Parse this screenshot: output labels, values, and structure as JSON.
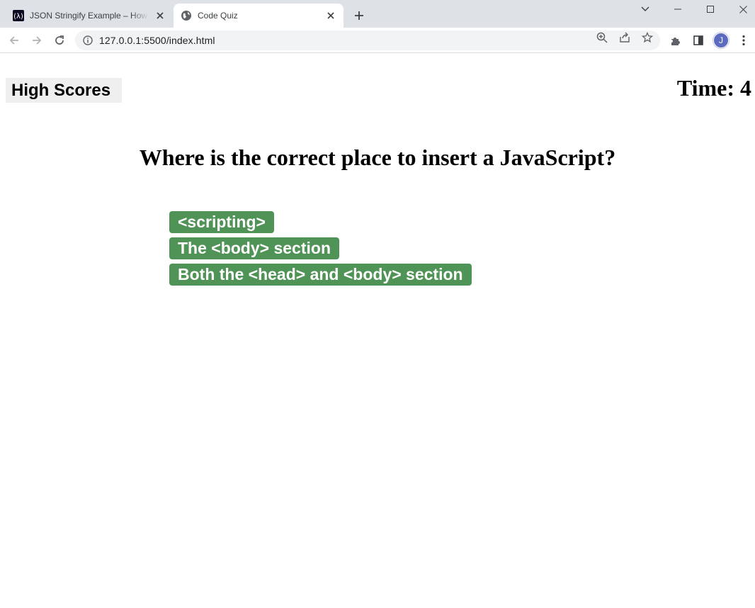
{
  "browser": {
    "tabs": [
      {
        "title": "JSON Stringify Example – How to",
        "active": false,
        "favicon": "freecodecamp-icon"
      },
      {
        "title": "Code Quiz",
        "active": true,
        "favicon": "globe-icon"
      }
    ],
    "url": "127.0.0.1:5500/index.html",
    "profile_initial": "J",
    "colors": {
      "tabstrip": "#dee1e6",
      "omnibox": "#f1f3f4",
      "avatar": "#5c6bc0"
    }
  },
  "page": {
    "high_scores_label": "High Scores",
    "timer_text": "Time: 4",
    "question": "Where is the correct place to insert a JavaScript?",
    "choices": [
      "<scripting>",
      "The <body> section",
      "Both the <head> and <body> section"
    ],
    "colors": {
      "choice_bg": "#4f9456",
      "choice_text": "#ffffff",
      "button_bg": "#efefef"
    }
  }
}
